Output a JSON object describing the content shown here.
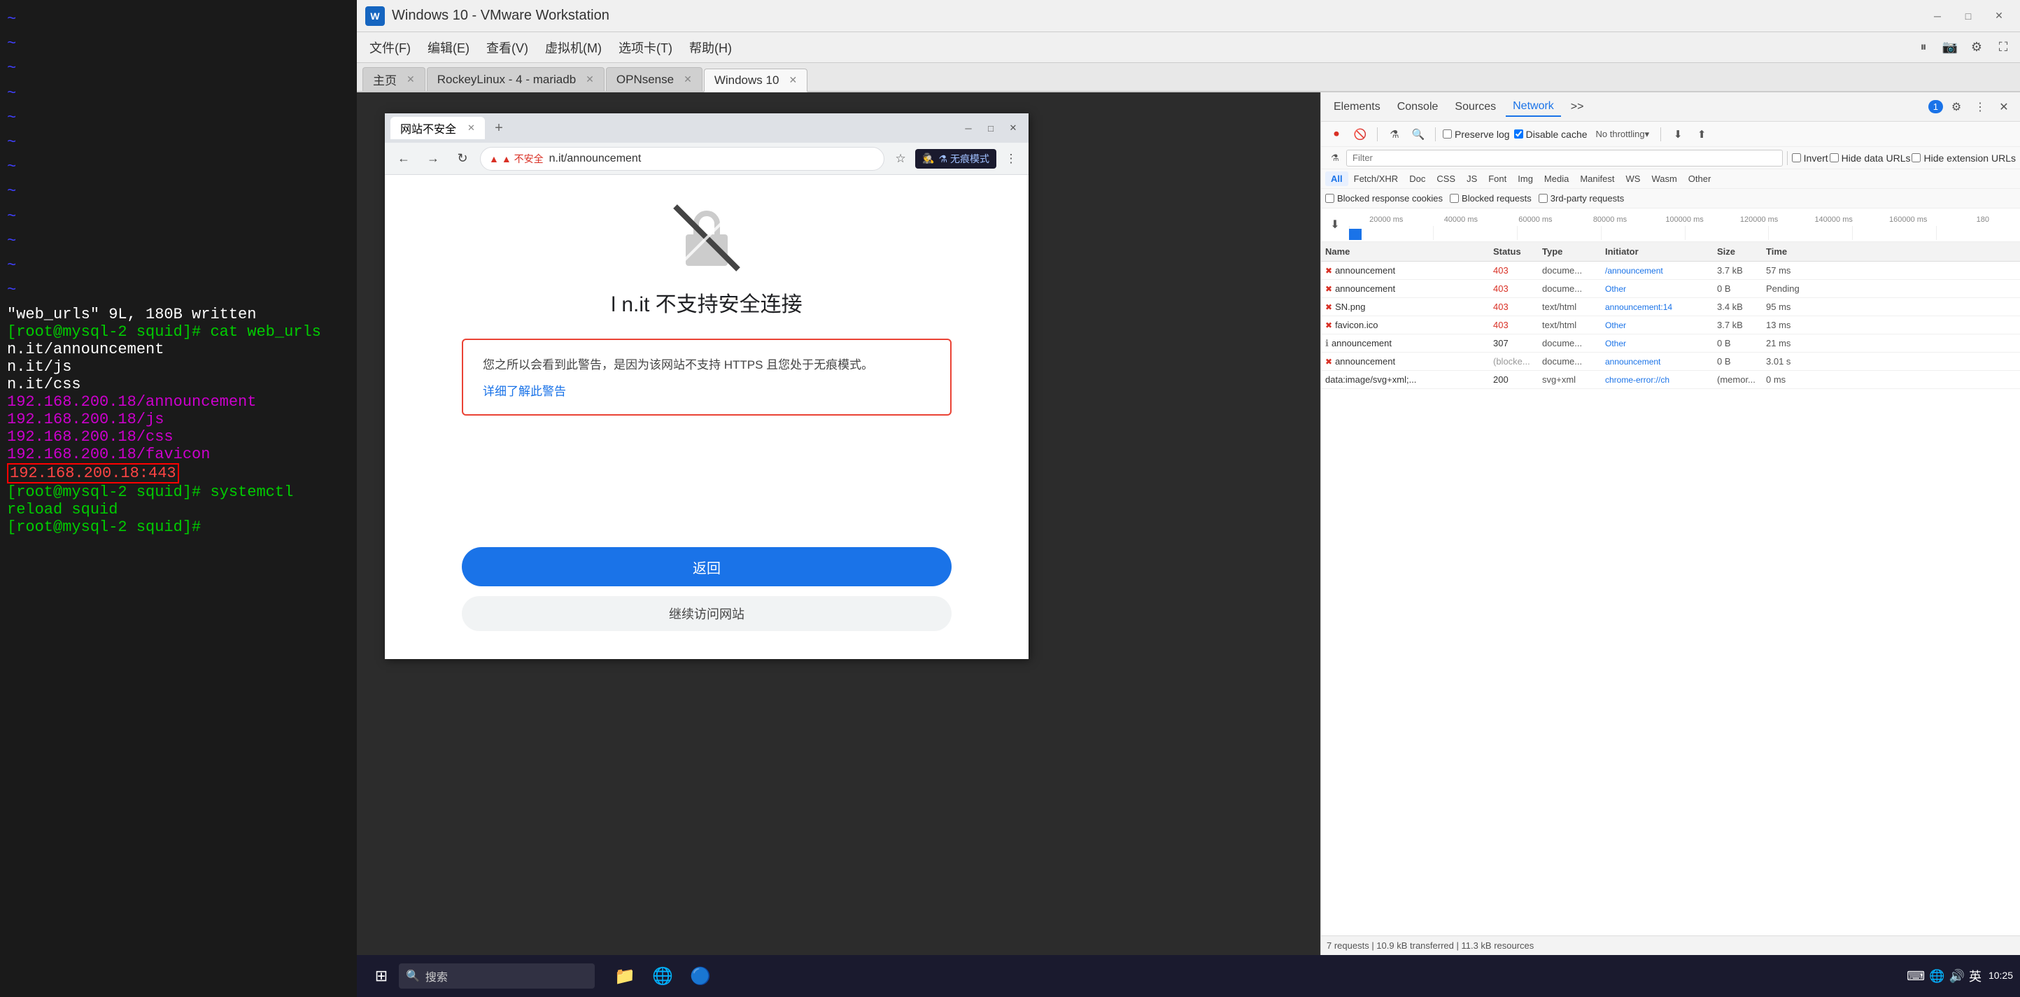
{
  "terminal": {
    "tildes": [
      "~",
      "~",
      "~",
      "~",
      "~",
      "~",
      "~",
      "~",
      "~",
      "~",
      "~",
      "~"
    ],
    "lines": [
      {
        "type": "white",
        "text": "\"web_urls\" 9L, 180B written"
      },
      {
        "type": "prompt",
        "text": "[root@mysql-2 squid]# cat web_urls"
      },
      {
        "type": "white",
        "text": "    n.it/announcement"
      },
      {
        "type": "white",
        "text": "    n.it/js"
      },
      {
        "type": "white",
        "text": "    n.it/css"
      },
      {
        "type": "magenta",
        "text": "192.168.200.18/announcement"
      },
      {
        "type": "magenta",
        "text": "192.168.200.18/js"
      },
      {
        "type": "magenta",
        "text": "192.168.200.18/css"
      },
      {
        "type": "magenta",
        "text": "192.168.200.18/favicon"
      },
      {
        "type": "red-highlight",
        "text": "192.168.200.18:443"
      },
      {
        "type": "prompt",
        "text": "[root@mysql-2 squid]# systemctl reload squid"
      },
      {
        "type": "prompt",
        "text": "[root@mysql-2 squid]# "
      }
    ]
  },
  "vmware": {
    "title": "Windows 10 - VMware Workstation",
    "menus": [
      "文件(F)",
      "编辑(E)",
      "查看(V)",
      "虚拟机(M)",
      "选项卡(T)",
      "帮助(H)"
    ],
    "tabs": [
      {
        "label": "主页",
        "active": false
      },
      {
        "label": "RockeyLinux - 4 - mariadb",
        "active": false
      },
      {
        "label": "OPNsense",
        "active": false
      },
      {
        "label": "Windows 10",
        "active": true
      }
    ]
  },
  "inner_browser": {
    "tab_title": "网站不安全",
    "url_warning": "▲ 不安全",
    "url_text": "n.it/announcement",
    "incognito_text": "⚗ 无痕模式",
    "error_page": {
      "title": "l    n.it 不支持安全连接",
      "desc": "您之所以会看到此警告，是因为该网站不支持 HTTPS 且您处于无痕模式。",
      "link_text": "详细了解此警告",
      "back_btn": "返回",
      "continue_btn": "继续访问网站"
    }
  },
  "devtools": {
    "panels": [
      "Elements",
      "Console",
      "Sources",
      "Network",
      ">>"
    ],
    "active_panel": "Network",
    "badge": "1",
    "toolbar": {
      "filter_placeholder": "Filter",
      "preserve_log": "Preserve log",
      "disable_cache": "Disable cache",
      "throttle": "No throttling",
      "invert_label": "Invert",
      "hide_data_urls": "Hide data URLs",
      "hide_ext_urls": "Hide extension URLs"
    },
    "filter_chips": [
      "All",
      "Fetch/XHR",
      "Doc",
      "CSS",
      "JS",
      "Font",
      "Img",
      "Media",
      "Manifest",
      "WS",
      "Wasm",
      "Other"
    ],
    "active_chip": "All",
    "second_filters": [
      "Blocked response cookies",
      "Blocked requests",
      "3rd-party requests"
    ],
    "timeline_labels": [
      "20000 ms",
      "40000 ms",
      "60000 ms",
      "80000 ms",
      "100000 ms",
      "120000 ms",
      "140000 ms",
      "160000 ms",
      "180"
    ],
    "table_headers": [
      "Name",
      "Status",
      "Type",
      "Initiator",
      "Size",
      "Time"
    ],
    "rows": [
      {
        "name": "announcement",
        "status": "403",
        "status_color": "error",
        "type": "docume...",
        "initiator": "/announcement",
        "size": "3.7 kB",
        "time": "57 ms",
        "icon": "error"
      },
      {
        "name": "announcement",
        "status": "403",
        "status_color": "error",
        "type": "docume...",
        "initiator": "Other",
        "size": "0 B",
        "time": "Pending",
        "icon": "error"
      },
      {
        "name": "SN.png",
        "status": "403",
        "status_color": "error",
        "type": "text/html",
        "initiator": "announcement:14",
        "size": "3.4 kB",
        "time": "95 ms",
        "icon": "error"
      },
      {
        "name": "favicon.ico",
        "status": "403",
        "status_color": "error",
        "type": "text/html",
        "initiator": "Other",
        "size": "3.7 kB",
        "time": "13 ms",
        "icon": "error"
      },
      {
        "name": "announcement",
        "status": "307",
        "status_color": "ok",
        "type": "docume...",
        "initiator": "Other",
        "size": "0 B",
        "time": "21 ms",
        "icon": "info"
      },
      {
        "name": "announcement",
        "status": "(blocke...",
        "status_color": "blocked",
        "type": "docume...",
        "initiator": "announcement",
        "size": "0 B",
        "time": "3.01 s",
        "icon": "error"
      },
      {
        "name": "data:image/svg+xml;...",
        "status": "200",
        "status_color": "ok",
        "type": "svg+xml",
        "initiator": "chrome-error://ch",
        "size": "(memor...",
        "time": "0 ms",
        "icon": "none"
      }
    ],
    "summary": "7 requests | 10.9 kB transferred | 11.3 kB resources"
  },
  "taskbar": {
    "search_placeholder": "搜索",
    "time": "10:25",
    "date": "",
    "sys_icons": [
      "🔊",
      "🌐",
      "⌨"
    ]
  }
}
